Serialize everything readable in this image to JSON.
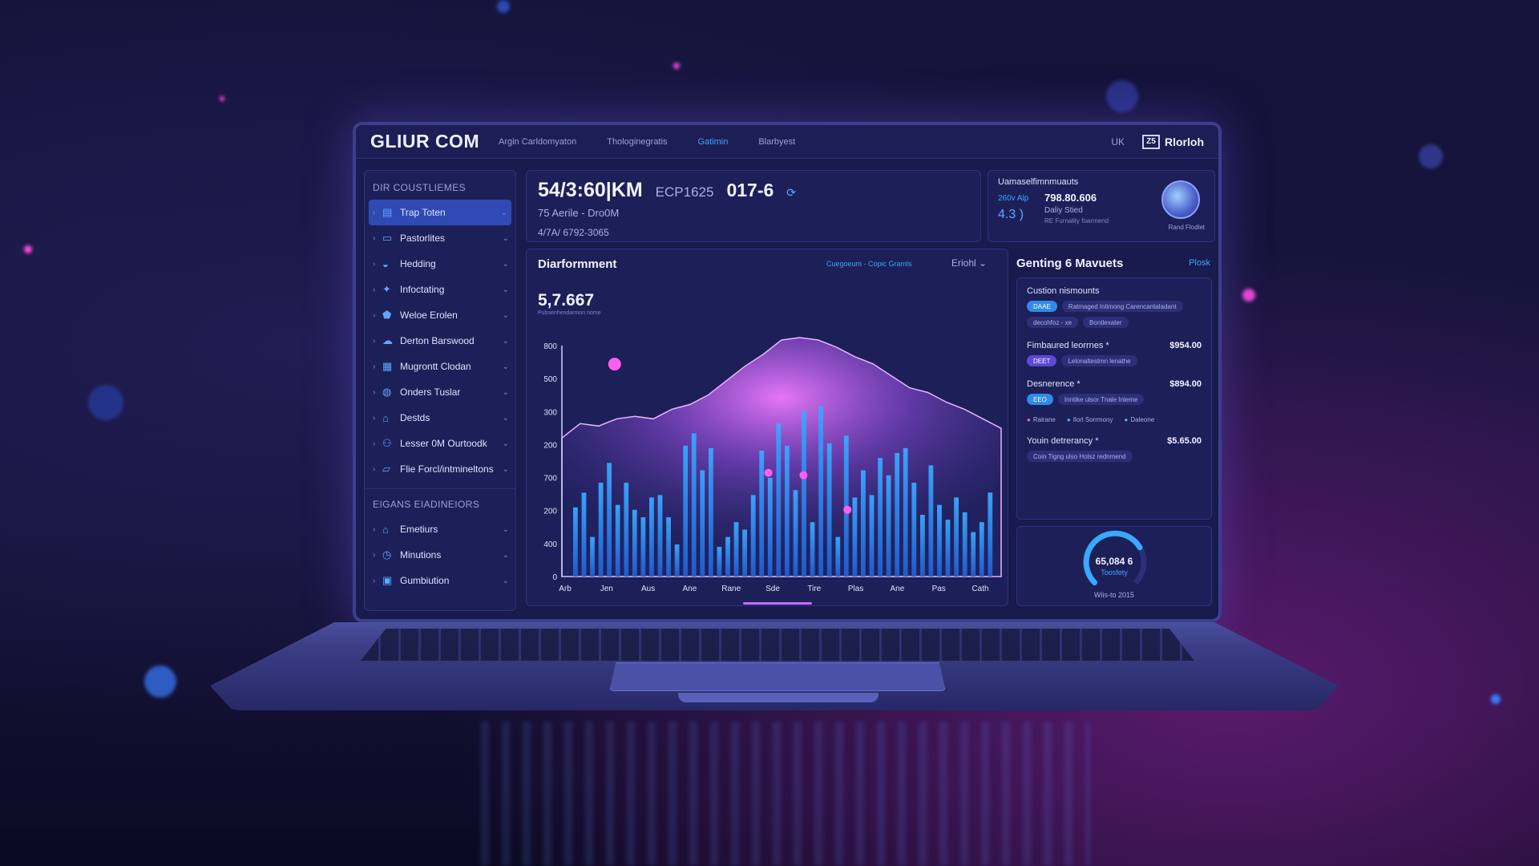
{
  "brand": "GLIUR COM",
  "nav": [
    "Argin Carldomyaton",
    "Thologinegratis",
    "Gatimin",
    "Blarbyest"
  ],
  "nav_active_index": 2,
  "top_icon": "UK",
  "user_badge": {
    "icon_text": "Z5",
    "name": "Rlorloh"
  },
  "sidebar": {
    "section1_title": "DIR COUSTLIEMES",
    "items1": [
      {
        "label": "Trap Toten",
        "icon": "doc-icon",
        "active": true
      },
      {
        "label": "Pastorlites",
        "icon": "card-icon"
      },
      {
        "label": "Hedding",
        "icon": "car-icon"
      },
      {
        "label": "Infoctating",
        "icon": "bird-icon"
      },
      {
        "label": "Weloe Erolen",
        "icon": "shield-icon"
      },
      {
        "label": "Derton Barswood",
        "icon": "cloud-icon"
      },
      {
        "label": "Mugrontt Clodan",
        "icon": "grid-icon"
      },
      {
        "label": "Onders Tuslar",
        "icon": "globe-icon"
      },
      {
        "label": "Destds",
        "icon": "home-icon"
      },
      {
        "label": "Lesser 0M Ourtoodk",
        "icon": "users-icon"
      },
      {
        "label": "Flie Forcl/intmineltons",
        "icon": "folder-icon"
      }
    ],
    "section2_title": "EIGANS EIADINEIORS",
    "items2": [
      {
        "label": "Emetiurs",
        "icon": "home-icon"
      },
      {
        "label": "Minutions",
        "icon": "clock-icon"
      },
      {
        "label": "Gumbiution",
        "icon": "box-icon"
      }
    ]
  },
  "stats_header": {
    "value1": "54/3:60|KM",
    "value2": "ECP1625",
    "value3": "017-6",
    "sub1": "75 Aerile - Dro0M",
    "sub2": "4/7A/ 6792-3065"
  },
  "account": {
    "title": "Uamaselfimnmuauts",
    "left_label": "260v Alp",
    "left_value": "4.3 )",
    "mid_value": "798.80.606",
    "mid_sub": "Daliy Stied",
    "mid_tiny": "RE Furnality foarmend",
    "avatar_label": "Rand Flodlet"
  },
  "chart_panel": {
    "title": "Diarformment",
    "legend": "Cuegoeum - Copic Gramls",
    "select": "Eriohl",
    "metric": "5,7.667",
    "metric_sub": "Pubsenhendarmon nome"
  },
  "chart_data": {
    "type": "bar",
    "y_tick_labels": [
      "800",
      "500",
      "300",
      "200",
      "700",
      "200",
      "400",
      "0"
    ],
    "x_tick_labels": [
      "Arb",
      "Jen",
      "Aus",
      "Ane",
      "Rane",
      "Sde",
      "Tire",
      "Plas",
      "Ane",
      "Pas",
      "Cath"
    ],
    "bar_values": [
      0.28,
      0.34,
      0.16,
      0.38,
      0.46,
      0.29,
      0.38,
      0.27,
      0.24,
      0.32,
      0.33,
      0.24,
      0.13,
      0.53,
      0.58,
      0.43,
      0.52,
      0.12,
      0.16,
      0.22,
      0.19,
      0.33,
      0.51,
      0.4,
      0.62,
      0.53,
      0.35,
      0.67,
      0.22,
      0.69,
      0.54,
      0.16,
      0.57,
      0.32,
      0.43,
      0.33,
      0.48,
      0.41,
      0.5,
      0.52,
      0.38,
      0.25,
      0.45,
      0.29,
      0.23,
      0.32,
      0.26,
      0.18,
      0.22,
      0.34
    ],
    "area_values": [
      0.58,
      0.64,
      0.63,
      0.66,
      0.67,
      0.66,
      0.7,
      0.72,
      0.76,
      0.82,
      0.88,
      0.93,
      0.99,
      1.0,
      0.99,
      0.96,
      0.92,
      0.89,
      0.84,
      0.79,
      0.77,
      0.73,
      0.7,
      0.66,
      0.62
    ],
    "highlight_points": [
      0.86,
      0.42,
      0.41,
      0.27
    ]
  },
  "right_panel": {
    "title": "Genting 6 Mavuets",
    "link": "Plosk",
    "section_title": "Custion nismounts",
    "pill_blue": "DAAE",
    "pill_text1": "Ratmaged Inlimong Carencantaladant",
    "pill_text2": "decohfoz - xe",
    "pill_text3": "Bontlexater",
    "row1_label": "Fimbaured leorrnes *",
    "row1_amount": "$954.00",
    "row1_pill": "DEET",
    "row1_pill_text": "Lelonaltestmn lenathe",
    "row2_label": "Desnerence *",
    "row2_amount": "$894.00",
    "row2_pill": "EEO",
    "row2_pill_text": "Inntike ulsor Tnale Inleme",
    "dots": [
      "Ralrane",
      "Ilorl Sorrmony",
      "Daleone"
    ],
    "row3_label": "Youin detrerancy *",
    "row3_amount": "$5.65.00",
    "row3_pill_text": "Coin Tigng ulso Holsz rednmend"
  },
  "gauge": {
    "value": "65,084 6",
    "sub": "Toosfety",
    "fraction": 0.72,
    "foot": "Wiis-to 2015"
  },
  "colors": {
    "accent": "#3aa8ff",
    "bar": "#2f8ae8",
    "glow": "#c86dff",
    "panel": "#1d1f58"
  }
}
